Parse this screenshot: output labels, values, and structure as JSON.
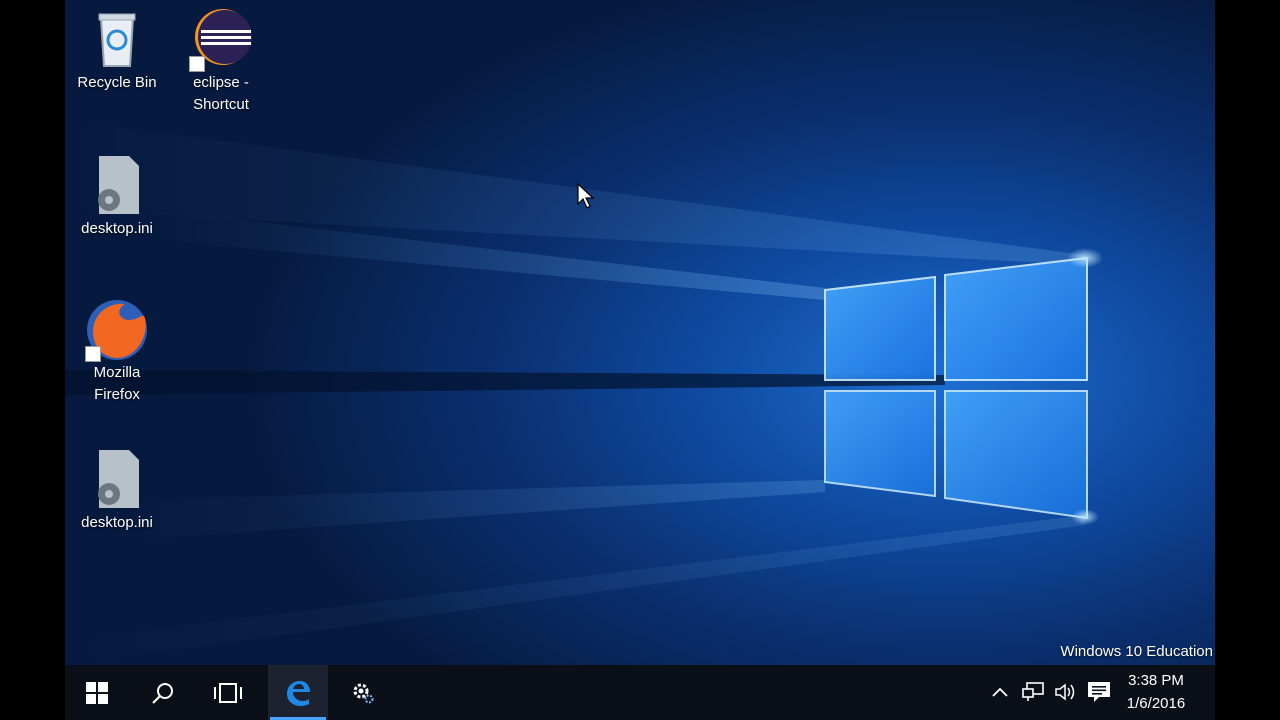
{
  "desktop": {
    "icons": [
      {
        "label": "Recycle Bin"
      },
      {
        "label": "eclipse -\nShortcut"
      },
      {
        "label": "desktop.ini"
      },
      {
        "label": "Mozilla\nFirefox"
      },
      {
        "label": "desktop.ini"
      }
    ],
    "watermark": "Windows 10 Education"
  },
  "taskbar": {
    "buttons": [
      "start-icon",
      "search-icon",
      "task-view-icon",
      "edge-icon",
      "settings-icon"
    ],
    "active_button": "edge-icon",
    "tray_icons": [
      "chevron-up-icon",
      "network-icon",
      "volume-icon",
      "action-center-icon"
    ],
    "clock": {
      "time": "3:38 PM",
      "date": "1/6/2016"
    }
  },
  "colors": {
    "accent": "#4aa3ff",
    "taskbar": "#0b0f17",
    "wallpaper": "#0f4aa0"
  }
}
